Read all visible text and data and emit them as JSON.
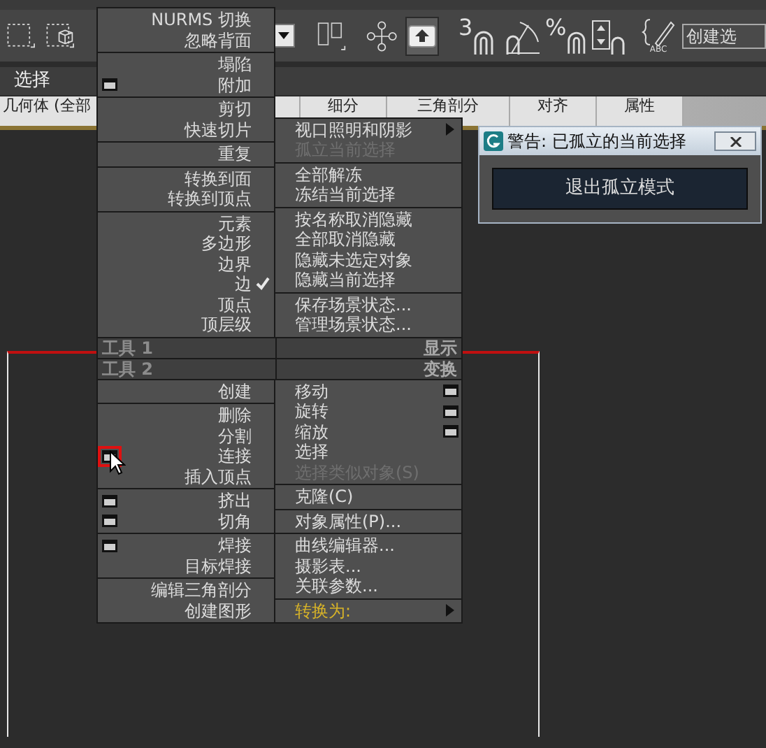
{
  "toolbar": {
    "snap_3d_label": "3",
    "percent_snap_label": "%",
    "abc_label": "ABC",
    "field_value": "创建选"
  },
  "ribbon": {
    "title": "选择"
  },
  "tabs": [
    {
      "label": "几何体 (全部"
    },
    {
      "label": "细分"
    },
    {
      "label": "三角剖分"
    },
    {
      "label": "对齐"
    },
    {
      "label": "属性"
    }
  ],
  "quad_menu": {
    "left_upper": [
      [
        {
          "label": "NURMS 切换",
          "kind": "plain"
        },
        {
          "label": "忽略背面",
          "kind": "plain"
        }
      ],
      [
        {
          "label": "塌陷",
          "kind": "plain"
        },
        {
          "label": "附加",
          "kind": "settings"
        }
      ],
      [
        {
          "label": "剪切",
          "kind": "plain"
        },
        {
          "label": "快速切片",
          "kind": "plain"
        }
      ],
      [
        {
          "label": "重复",
          "kind": "plain"
        }
      ],
      [
        {
          "label": "转换到面",
          "kind": "plain"
        },
        {
          "label": "转换到顶点",
          "kind": "plain"
        }
      ],
      [
        {
          "label": "元素",
          "kind": "plain",
          "checked": false
        },
        {
          "label": "多边形",
          "kind": "plain",
          "checked": false
        },
        {
          "label": "边界",
          "kind": "plain",
          "checked": false
        },
        {
          "label": "边",
          "kind": "plain",
          "checked": true
        },
        {
          "label": "顶点",
          "kind": "plain",
          "checked": false
        },
        {
          "label": "顶层级",
          "kind": "plain",
          "checked": false
        }
      ]
    ],
    "right_upper": [
      [
        {
          "label": "视口照明和阴影",
          "kind": "submenu",
          "disabled": false
        },
        {
          "label": "孤立当前选择",
          "kind": "plain",
          "disabled": true
        }
      ],
      [
        {
          "label": "全部解冻",
          "kind": "plain",
          "disabled": false
        },
        {
          "label": "冻结当前选择",
          "kind": "plain",
          "disabled": false
        }
      ],
      [
        {
          "label": "按名称取消隐藏",
          "kind": "plain",
          "disabled": false
        },
        {
          "label": "全部取消隐藏",
          "kind": "plain",
          "disabled": false
        },
        {
          "label": "隐藏未选定对象",
          "kind": "plain",
          "disabled": false
        },
        {
          "label": "隐藏当前选择",
          "kind": "plain",
          "disabled": false
        }
      ],
      [
        {
          "label": "保存场景状态...",
          "kind": "plain",
          "disabled": false
        },
        {
          "label": "管理场景状态...",
          "kind": "plain",
          "disabled": false
        }
      ]
    ],
    "headers": [
      {
        "left": "工具 1",
        "right": "显示"
      },
      {
        "left": "工具 2",
        "right": "变换"
      }
    ],
    "left_lower": [
      [
        {
          "label": "创建",
          "kind": "plain",
          "hovered": false
        }
      ],
      [
        {
          "label": "删除",
          "kind": "plain",
          "hovered": false
        },
        {
          "label": "分割",
          "kind": "plain",
          "hovered": false
        },
        {
          "label": "连接",
          "kind": "settings",
          "hovered": true
        },
        {
          "label": "插入顶点",
          "kind": "plain",
          "hovered": false
        }
      ],
      [
        {
          "label": "挤出",
          "kind": "settings",
          "hovered": false
        },
        {
          "label": "切角",
          "kind": "settings",
          "hovered": false
        }
      ],
      [
        {
          "label": "焊接",
          "kind": "settings",
          "hovered": false
        },
        {
          "label": "目标焊接",
          "kind": "plain",
          "hovered": false
        }
      ],
      [
        {
          "label": "编辑三角剖分",
          "kind": "plain",
          "hovered": false
        },
        {
          "label": "创建图形",
          "kind": "plain",
          "hovered": false
        }
      ]
    ],
    "right_lower": [
      [
        {
          "label": "移动",
          "kind": "settings",
          "disabled": false
        },
        {
          "label": "旋转",
          "kind": "settings",
          "disabled": false
        },
        {
          "label": "缩放",
          "kind": "settings",
          "disabled": false
        },
        {
          "label": "选择",
          "kind": "plain",
          "disabled": false
        },
        {
          "label": "选择类似对象(S)",
          "kind": "plain",
          "disabled": true
        }
      ],
      [
        {
          "label": "克隆(C)",
          "kind": "plain",
          "disabled": false
        }
      ],
      [
        {
          "label": "对象属性(P)...",
          "kind": "plain",
          "disabled": false
        }
      ],
      [
        {
          "label": "曲线编辑器...",
          "kind": "plain",
          "disabled": false
        },
        {
          "label": "摄影表...",
          "kind": "plain",
          "disabled": false
        },
        {
          "label": "关联参数...",
          "kind": "plain",
          "disabled": false
        }
      ],
      [
        {
          "label": "转换为:",
          "kind": "accent",
          "disabled": false
        }
      ]
    ]
  },
  "dialog": {
    "title": "警告: 已孤立的当前选择",
    "button": "退出孤立模式"
  }
}
